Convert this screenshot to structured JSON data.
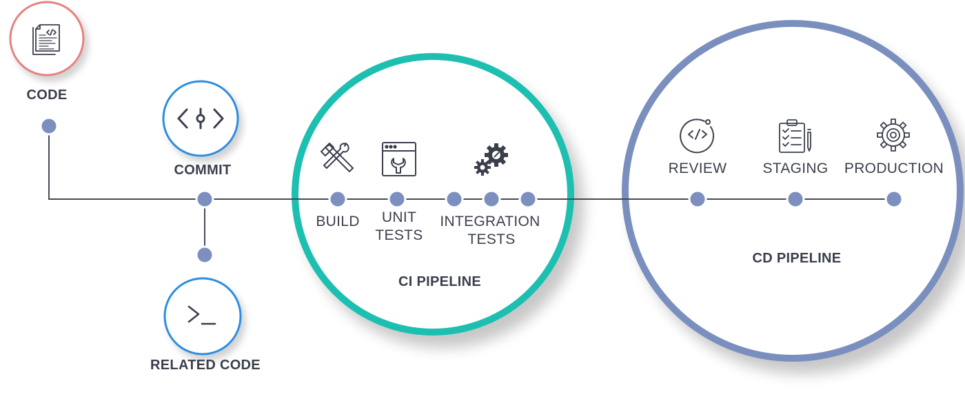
{
  "colors": {
    "code_ring": "#e8807d",
    "commit_ring": "#2c8de0",
    "ci_ring": "#1dbfb0",
    "cd_ring": "#7a8fbd",
    "node": "#7d8fbf",
    "line": "#444a55",
    "icon": "#3a3f4b",
    "text": "#3a3f4b"
  },
  "labels": {
    "code": "CODE",
    "commit": "COMMIT",
    "related_code": "RELATED CODE",
    "ci_pipeline": "CI PIPELINE",
    "cd_pipeline": "CD PIPELINE"
  },
  "ci_steps": {
    "build": "BUILD",
    "unit_tests_line1": "UNIT",
    "unit_tests_line2": "TESTS",
    "integration_line1": "INTEGRATION",
    "integration_line2": "TESTS"
  },
  "cd_steps": {
    "review": "REVIEW",
    "staging": "STAGING",
    "production": "PRODUCTION"
  },
  "icons": {
    "code": "code-document-icon",
    "commit": "commit-icon",
    "related_code": "terminal-icon",
    "build": "hammer-wrench-icon",
    "unit_tests": "browser-wrench-icon",
    "integration_tests": "gears-icon",
    "review": "code-review-icon",
    "staging": "clipboard-checklist-icon",
    "production": "gear-icon"
  }
}
